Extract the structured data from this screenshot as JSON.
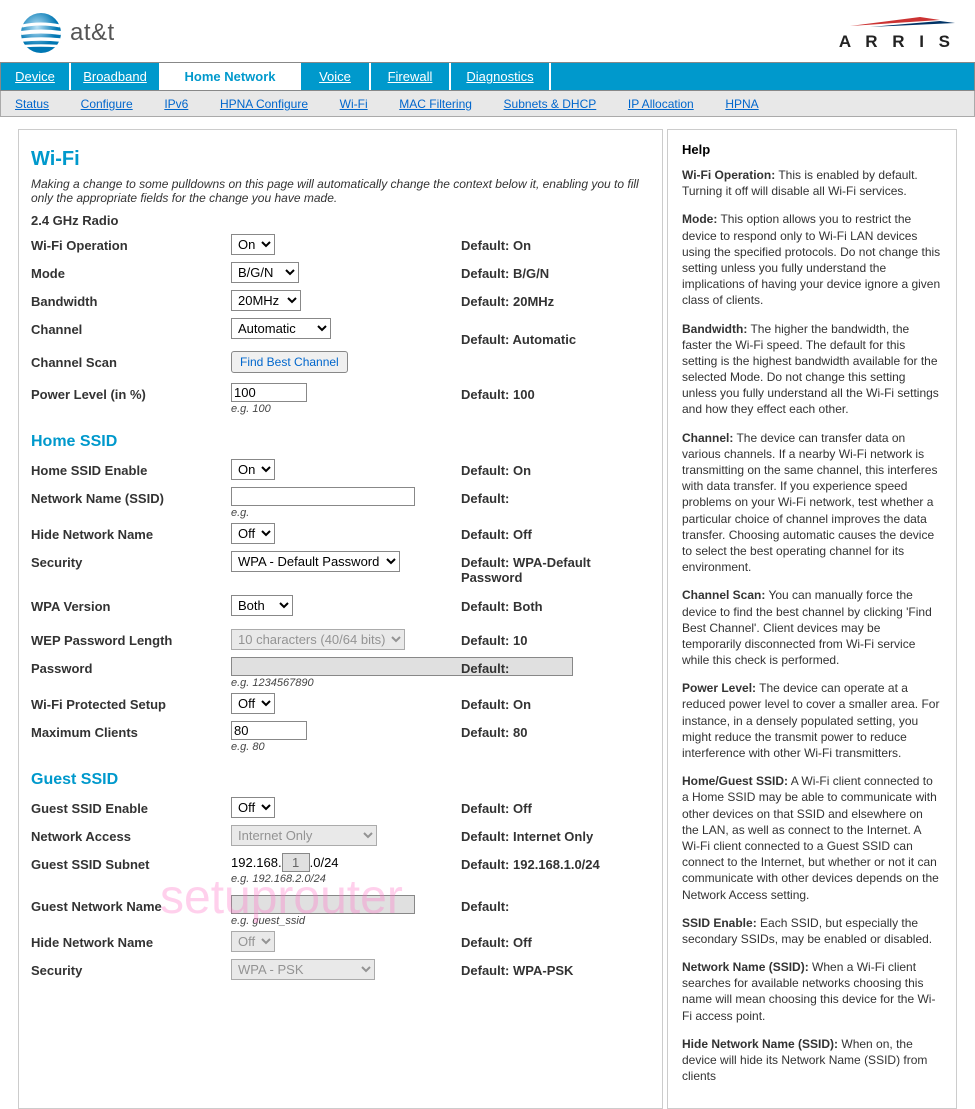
{
  "brand": {
    "att": "at&t",
    "arris": "A R R I S"
  },
  "nav": {
    "main": [
      "Device",
      "Broadband",
      "Home Network",
      "Voice",
      "Firewall",
      "Diagnostics"
    ],
    "sub": [
      "Status",
      "Configure",
      "IPv6",
      "HPNA Configure",
      "Wi-Fi",
      "MAC Filtering",
      "Subnets & DHCP",
      "IP Allocation",
      "HPNA"
    ]
  },
  "page": {
    "title": "Wi-Fi",
    "intro": "Making a change to some pulldowns on this page will automatically change the context below it, enabling you to fill only the appropriate fields for the change you have made.",
    "radio_section": "2.4 GHz Radio",
    "home_ssid_section": "Home SSID",
    "guest_ssid_section": "Guest SSID"
  },
  "radio": {
    "wifi_op": {
      "label": "Wi-Fi Operation",
      "value": "On",
      "default": "Default: On"
    },
    "mode": {
      "label": "Mode",
      "value": "B/G/N",
      "default": "Default: B/G/N"
    },
    "bandwidth": {
      "label": "Bandwidth",
      "value": "20MHz",
      "default": "Default: 20MHz"
    },
    "channel": {
      "label": "Channel",
      "value": "Automatic",
      "default": "Default: Automatic"
    },
    "scan": {
      "label": "Channel Scan",
      "button": "Find Best Channel"
    },
    "power": {
      "label": "Power Level (in %)",
      "value": "100",
      "hint": "e.g. 100",
      "default": "Default: 100"
    }
  },
  "home": {
    "enable": {
      "label": "Home SSID Enable",
      "value": "On",
      "default": "Default: On"
    },
    "ssid": {
      "label": "Network Name (SSID)",
      "value": "",
      "hint": "e.g.",
      "default": "Default:"
    },
    "hide": {
      "label": "Hide Network Name",
      "value": "Off",
      "default": "Default: Off"
    },
    "security": {
      "label": "Security",
      "value": "WPA - Default Password",
      "default": "Default: WPA-Default Password"
    },
    "wpa_ver": {
      "label": "WPA Version",
      "value": "Both",
      "default": "Default: Both"
    },
    "wep_len": {
      "label": "WEP Password Length",
      "value": "10 characters (40/64 bits)",
      "default": "Default: 10"
    },
    "password": {
      "label": "Password",
      "value": "",
      "hint": "e.g. 1234567890",
      "default": "Default:"
    },
    "wps": {
      "label": "Wi-Fi Protected Setup",
      "value": "Off",
      "default": "Default: On"
    },
    "max_clients": {
      "label": "Maximum Clients",
      "value": "80",
      "hint": "e.g. 80",
      "default": "Default: 80"
    }
  },
  "guest": {
    "enable": {
      "label": "Guest SSID Enable",
      "value": "Off",
      "default": "Default: Off"
    },
    "access": {
      "label": "Network Access",
      "value": "Internet Only",
      "default": "Default: Internet Only"
    },
    "subnet": {
      "label": "Guest SSID Subnet",
      "prefix": "192.168.",
      "octet": "1",
      "suffix": ".0/24",
      "hint": "e.g. 192.168.2.0/24",
      "default": "Default: 192.168.1.0/24"
    },
    "name": {
      "label": "Guest Network Name",
      "value": "",
      "hint": "e.g. guest_ssid",
      "default": "Default:"
    },
    "hide": {
      "label": "Hide Network Name",
      "value": "Off",
      "default": "Default: Off"
    },
    "security": {
      "label": "Security",
      "value": "WPA - PSK",
      "default": "Default: WPA-PSK"
    }
  },
  "help": {
    "title": "Help",
    "items": [
      {
        "b": "Wi-Fi Operation:",
        "t": " This is enabled by default. Turning it off will disable all Wi-Fi services."
      },
      {
        "b": "Mode:",
        "t": " This option allows you to restrict the device to respond only to Wi-Fi LAN devices using the specified protocols. Do not change this setting unless you fully understand the implications of having your device ignore a given class of clients."
      },
      {
        "b": "Bandwidth:",
        "t": " The higher the bandwidth, the faster the Wi-Fi speed. The default for this setting is the highest bandwidth available for the selected Mode. Do not change this setting unless you fully understand all the Wi-Fi settings and how they effect each other."
      },
      {
        "b": "Channel:",
        "t": " The device can transfer data on various channels. If a nearby Wi-Fi network is transmitting on the same channel, this interferes with data transfer. If you experience speed problems on your Wi-Fi network, test whether a particular choice of channel improves the data transfer. Choosing automatic causes the device to select the best operating channel for its environment."
      },
      {
        "b": "Channel Scan:",
        "t": " You can manually force the device to find the best channel by clicking 'Find Best Channel'. Client devices may be temporarily disconnected from Wi-Fi service while this check is performed."
      },
      {
        "b": "Power Level:",
        "t": " The device can operate at a reduced power level to cover a smaller area. For instance, in a densely populated setting, you might reduce the transmit power to reduce interference with other Wi-Fi transmitters."
      },
      {
        "b": "Home/Guest SSID:",
        "t": " A Wi-Fi client connected to a Home SSID may be able to communicate with other devices on that SSID and elsewhere on the LAN, as well as connect to the Internet. A Wi-Fi client connected to a Guest SSID can connect to the Internet, but whether or not it can communicate with other devices depends on the Network Access setting."
      },
      {
        "b": "SSID Enable:",
        "t": " Each SSID, but especially the secondary SSIDs, may be enabled or disabled."
      },
      {
        "b": "Network Name (SSID):",
        "t": " When a Wi-Fi client searches for available networks choosing this name will mean choosing this device for the Wi-Fi access point."
      },
      {
        "b": "Hide Network Name (SSID):",
        "t": " When on, the device will hide its Network Name (SSID) from clients"
      }
    ]
  },
  "watermark": "setuprouter"
}
